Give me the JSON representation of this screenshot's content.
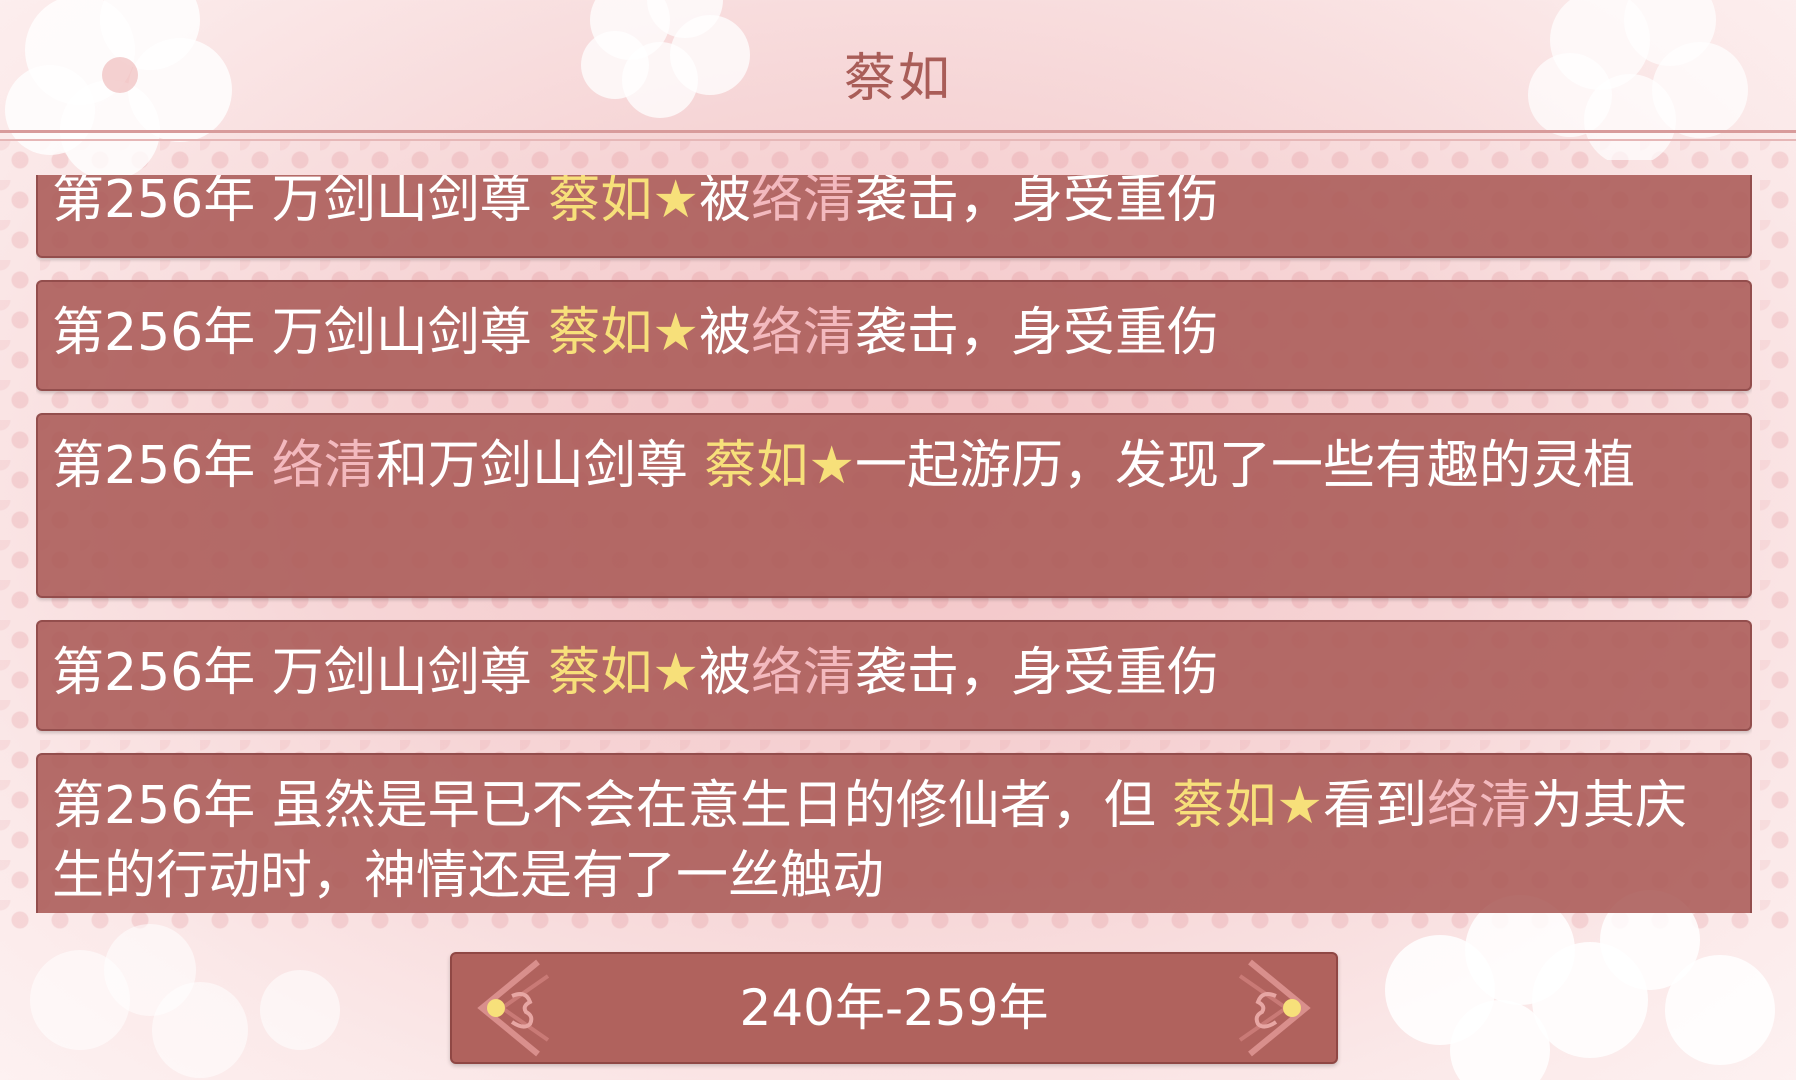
{
  "header": {
    "title": "蔡如"
  },
  "entries": [
    {
      "parts": [
        {
          "text": "第256年 万剑山剑尊 ",
          "style": "plain"
        },
        {
          "text": "蔡如★",
          "style": "main"
        },
        {
          "text": "被",
          "style": "plain"
        },
        {
          "text": "络清",
          "style": "other"
        },
        {
          "text": "袭击，身受重伤",
          "style": "plain"
        }
      ]
    },
    {
      "parts": [
        {
          "text": "第256年 万剑山剑尊 ",
          "style": "plain"
        },
        {
          "text": "蔡如★",
          "style": "main"
        },
        {
          "text": "被",
          "style": "plain"
        },
        {
          "text": "络清",
          "style": "other"
        },
        {
          "text": "袭击，身受重伤",
          "style": "plain"
        }
      ]
    },
    {
      "parts": [
        {
          "text": "第256年 ",
          "style": "plain"
        },
        {
          "text": "络清",
          "style": "other"
        },
        {
          "text": "和万剑山剑尊 ",
          "style": "plain"
        },
        {
          "text": "蔡如★",
          "style": "main"
        },
        {
          "text": "一起游历，发现了一些有趣的灵植",
          "style": "plain"
        }
      ]
    },
    {
      "parts": [
        {
          "text": "第256年 万剑山剑尊 ",
          "style": "plain"
        },
        {
          "text": "蔡如★",
          "style": "main"
        },
        {
          "text": "被",
          "style": "plain"
        },
        {
          "text": "络清",
          "style": "other"
        },
        {
          "text": "袭击，身受重伤",
          "style": "plain"
        }
      ]
    },
    {
      "parts": [
        {
          "text": "第256年 虽然是早已不会在意生日的修仙者，但 ",
          "style": "plain"
        },
        {
          "text": "蔡如★",
          "style": "main"
        },
        {
          "text": "看到",
          "style": "plain"
        },
        {
          "text": "络清",
          "style": "other"
        },
        {
          "text": "为其庆生的行动时，神情还是有了一丝触动",
          "style": "plain"
        }
      ]
    }
  ],
  "pager": {
    "label": "240年-259年"
  },
  "colors": {
    "main_name": "#f7e07a",
    "other_name": "#f3b9be",
    "entry_bg": "#aa5a56",
    "title": "#a95d58"
  }
}
